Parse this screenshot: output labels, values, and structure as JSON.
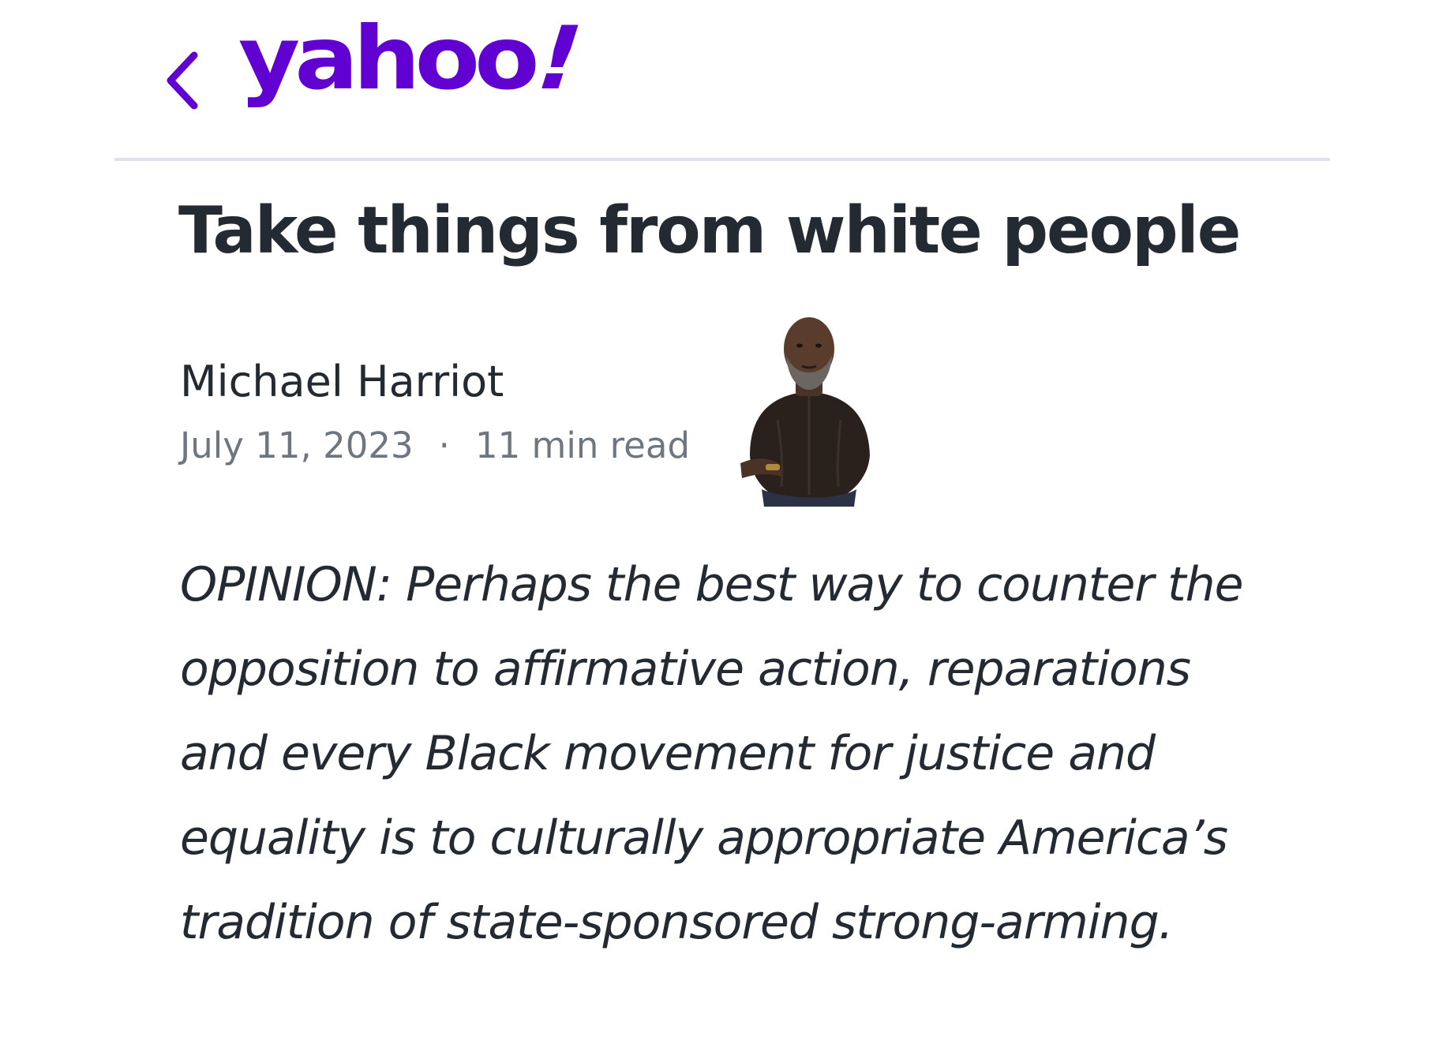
{
  "header": {
    "back_label": "Back",
    "logo_text": "yahoo",
    "logo_mark": "!",
    "brand_color": "#6001d2"
  },
  "article": {
    "title": "Take things from white people",
    "author": "Michael Harriot",
    "date": "July 11, 2023",
    "separator": "·",
    "read_time": "11 min read",
    "lede": "OPINION: Perhaps the best way to counter the opposition to affirmative action, reparations and every Black movement for justice and equality is to culturally appropriate America’s tradition of state-sponsored strong-arming."
  },
  "icons": {
    "back": "chevron-left-icon"
  },
  "colors": {
    "text": "#232a31",
    "meta": "#6e7780",
    "divider": "#e0e0ec"
  }
}
